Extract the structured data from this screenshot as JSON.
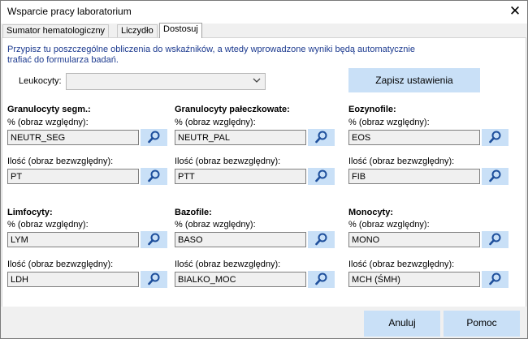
{
  "window": {
    "title": "Wsparcie pracy laboratorium",
    "close_symbol": "✕"
  },
  "tabs": [
    {
      "label": "Sumator hematologiczny"
    },
    {
      "label": "Liczydło"
    },
    {
      "label": "Dostosuj",
      "selected": true
    }
  ],
  "intro_line1": "Przypisz tu poszczególne obliczenia do wskaźników, a wtedy wprowadzone wyniki będą automatycznie",
  "intro_line2": "trafiać do formularza badań.",
  "leukocyty": {
    "label": "Leukocyty:",
    "value": ""
  },
  "save_button": "Zapisz ustawienia",
  "groups": [
    {
      "title": "Granulocyty segm.:",
      "pct_label": "% (obraz względny):",
      "pct_value": "NEUTR_SEG",
      "abs_label": "Ilość (obraz bezwzględny):",
      "abs_value": "PT"
    },
    {
      "title": "Granulocyty pałeczkowate:",
      "pct_label": "% (obraz względny):",
      "pct_value": "NEUTR_PAL",
      "abs_label": "Ilość (obraz bezwzględny):",
      "abs_value": "PTT"
    },
    {
      "title": "Eozynofile:",
      "pct_label": "% (obraz względny):",
      "pct_value": "EOS",
      "abs_label": "Ilość (obraz bezwzględny):",
      "abs_value": "FIB"
    },
    {
      "title": "Limfocyty:",
      "pct_label": "% (obraz względny):",
      "pct_value": "LYM",
      "abs_label": "Ilość (obraz bezwzględny):",
      "abs_value": "LDH"
    },
    {
      "title": "Bazofile:",
      "pct_label": "% (obraz względny):",
      "pct_value": "BASO",
      "abs_label": "Ilość (obraz bezwzględny):",
      "abs_value": "BIALKO_MOC"
    },
    {
      "title": "Monocyty:",
      "pct_label": "% (obraz względny):",
      "pct_value": "MONO",
      "abs_label": "Ilość (obraz bezwzględny):",
      "abs_value": "MCH (ŚMH)"
    }
  ],
  "search_icon": "magnifier-icon",
  "footer": {
    "cancel": "Anuluj",
    "help": "Pomoc"
  },
  "colors": {
    "button_bg": "#c9e0f7",
    "intro_text": "#1c3a8f",
    "icon": "#1e4f9c"
  }
}
